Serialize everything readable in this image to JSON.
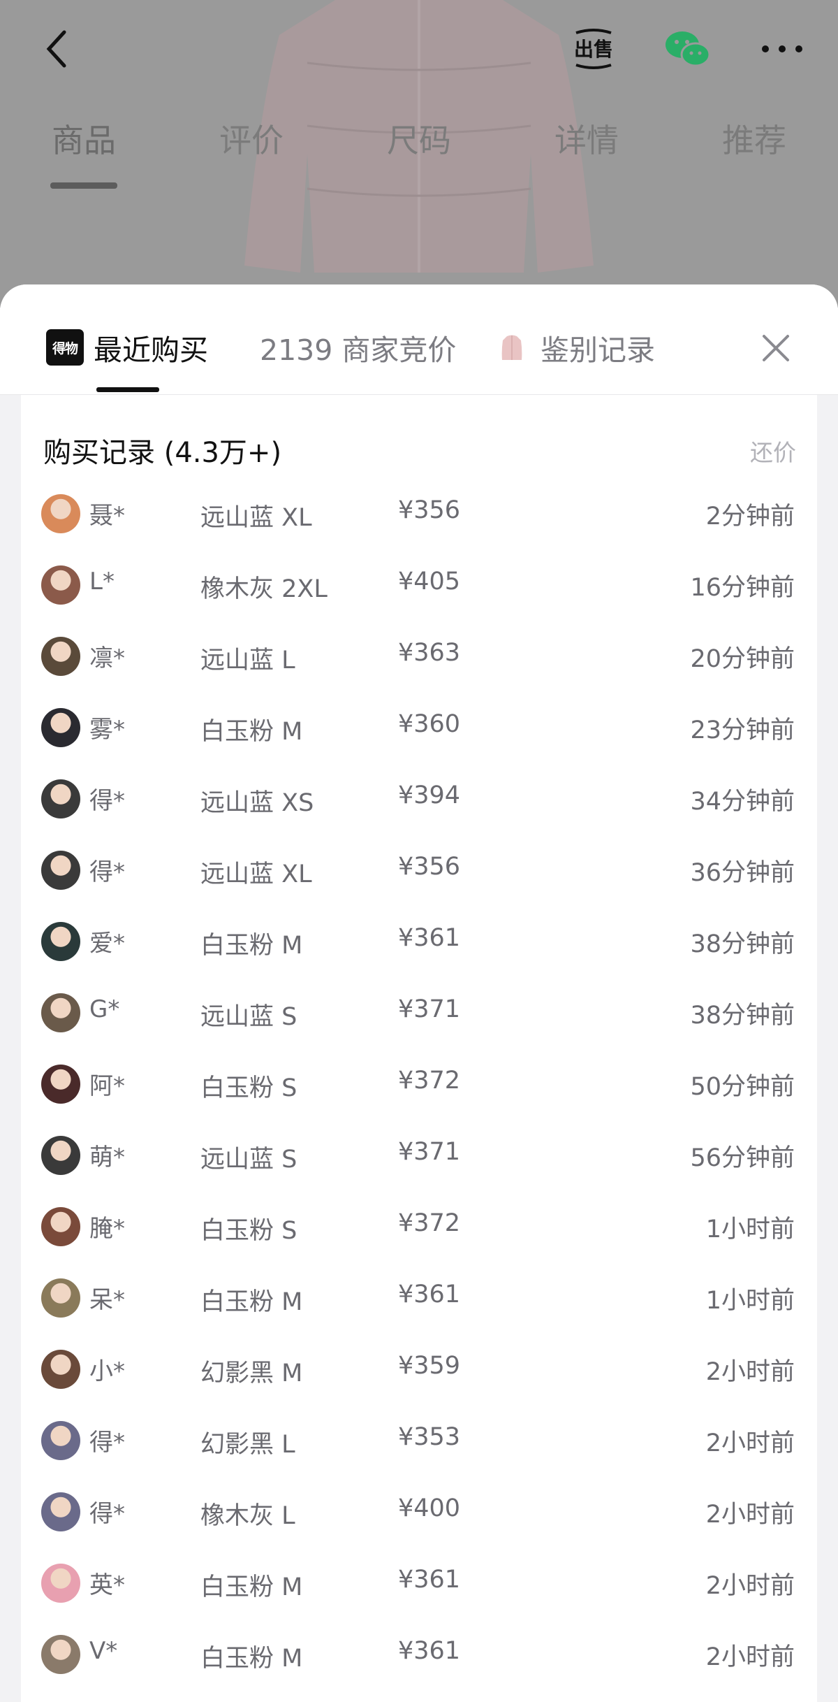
{
  "colors": {
    "overlay": "#9a9a9a",
    "accent": "#111111",
    "text": "#6a6a70",
    "muted": "#b2b2b8",
    "wechat": "#2aae67"
  },
  "nav": {
    "back_icon": "chevron-left-icon",
    "sell_label": "出售",
    "share_icon": "wechat-icon",
    "more_icon": "more-dots-icon"
  },
  "product_tabs": [
    "商品",
    "评价",
    "尺码",
    "详情",
    "推荐"
  ],
  "sheet": {
    "logo_text": "得物",
    "tabs": [
      "最近购买",
      "2139 商家竞价",
      "鉴别记录"
    ],
    "close_icon": "close-icon"
  },
  "records": {
    "title": "购买记录 (4.3万+)",
    "action": "还价",
    "rows": [
      {
        "name": "聂*",
        "spec": "远山蓝 XL",
        "price": "¥356",
        "time": "2分钟前",
        "avatar": "#d98a5a"
      },
      {
        "name": "L*",
        "spec": "橡木灰 2XL",
        "price": "¥405",
        "time": "16分钟前",
        "avatar": "#8b5a4a"
      },
      {
        "name": "凛*",
        "spec": "远山蓝 L",
        "price": "¥363",
        "time": "20分钟前",
        "avatar": "#5a4a3a"
      },
      {
        "name": "雾*",
        "spec": "白玉粉 M",
        "price": "¥360",
        "time": "23分钟前",
        "avatar": "#2a2a30"
      },
      {
        "name": "得*",
        "spec": "远山蓝 XS",
        "price": "¥394",
        "time": "34分钟前",
        "avatar": "#3a3a3a"
      },
      {
        "name": "得*",
        "spec": "远山蓝 XL",
        "price": "¥356",
        "time": "36分钟前",
        "avatar": "#3a3a3a"
      },
      {
        "name": "爱*",
        "spec": "白玉粉 M",
        "price": "¥361",
        "time": "38分钟前",
        "avatar": "#2a3a3a"
      },
      {
        "name": "G*",
        "spec": "远山蓝 S",
        "price": "¥371",
        "time": "38分钟前",
        "avatar": "#6a5a4a"
      },
      {
        "name": "阿*",
        "spec": "白玉粉 S",
        "price": "¥372",
        "time": "50分钟前",
        "avatar": "#4a2a2a"
      },
      {
        "name": "萌*",
        "spec": "远山蓝 S",
        "price": "¥371",
        "time": "56分钟前",
        "avatar": "#3a3a3a"
      },
      {
        "name": "腌*",
        "spec": "白玉粉 S",
        "price": "¥372",
        "time": "1小时前",
        "avatar": "#7a4a3a"
      },
      {
        "name": "呆*",
        "spec": "白玉粉 M",
        "price": "¥361",
        "time": "1小时前",
        "avatar": "#8a7a5a"
      },
      {
        "name": "小*",
        "spec": "幻影黑 M",
        "price": "¥359",
        "time": "2小时前",
        "avatar": "#6a4a3a"
      },
      {
        "name": "得*",
        "spec": "幻影黑 L",
        "price": "¥353",
        "time": "2小时前",
        "avatar": "#6a6a8a"
      },
      {
        "name": "得*",
        "spec": "橡木灰 L",
        "price": "¥400",
        "time": "2小时前",
        "avatar": "#6a6a8a"
      },
      {
        "name": "英*",
        "spec": "白玉粉 M",
        "price": "¥361",
        "time": "2小时前",
        "avatar": "#e8a0b0"
      },
      {
        "name": "V*",
        "spec": "白玉粉 M",
        "price": "¥361",
        "time": "2小时前",
        "avatar": "#8a7a6a"
      }
    ]
  }
}
